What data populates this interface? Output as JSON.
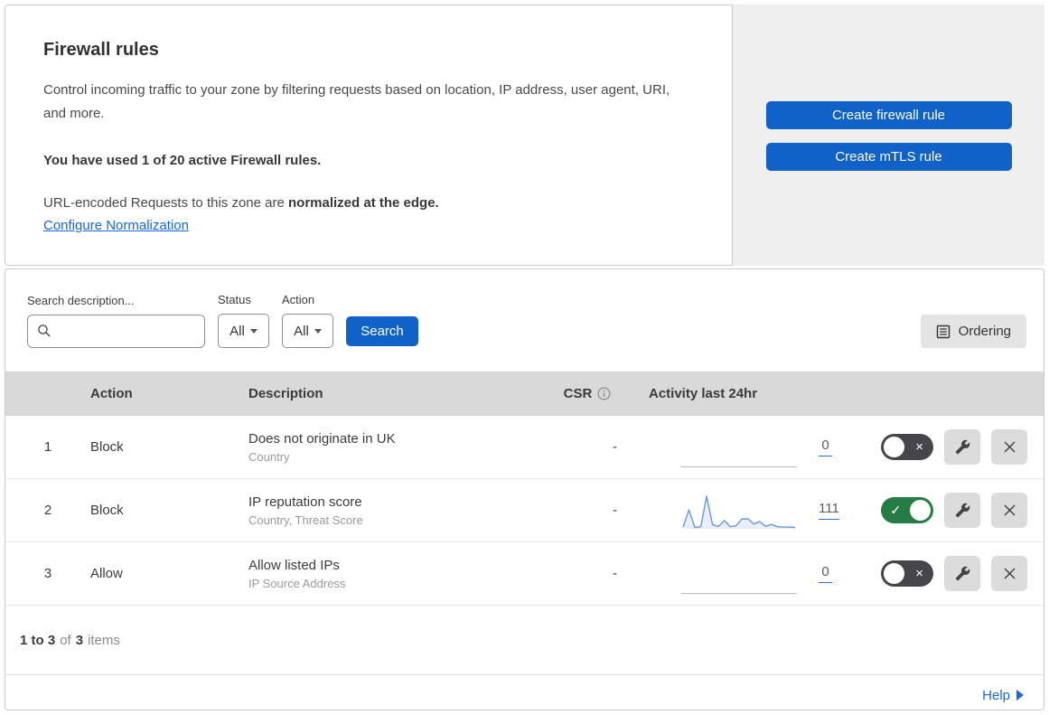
{
  "header": {
    "title": "Firewall rules",
    "description": "Control incoming traffic to your zone by filtering requests based on location, IP address, user agent, URI, and more.",
    "usage_note": "You have used 1 of 20 active Firewall rules.",
    "normalization_prefix": "URL-encoded Requests to this zone are ",
    "normalization_bold": "normalized at the edge.",
    "normalization_link": "Configure Normalization",
    "create_firewall_button": "Create firewall rule",
    "create_mtls_button": "Create mTLS rule"
  },
  "filters": {
    "search_label": "Search description...",
    "search_value": "",
    "status_label": "Status",
    "status_value": "All",
    "action_label": "Action",
    "action_value": "All",
    "search_button": "Search",
    "ordering_button": "Ordering"
  },
  "table": {
    "columns": {
      "action": "Action",
      "description": "Description",
      "csr": "CSR",
      "activity": "Activity last 24hr"
    },
    "rows": [
      {
        "num": "1",
        "action": "Block",
        "description": "Does not originate in UK",
        "fields": "Country",
        "csr": "-",
        "count": "0",
        "enabled": false,
        "sparkline": []
      },
      {
        "num": "2",
        "action": "Block",
        "description": "IP reputation score",
        "fields": "Country, Threat Score",
        "csr": "-",
        "count": "111",
        "enabled": true,
        "sparkline": [
          5,
          55,
          4,
          6,
          95,
          12,
          7,
          24,
          6,
          9,
          29,
          29,
          14,
          21,
          7,
          13,
          6,
          5,
          5,
          4
        ]
      },
      {
        "num": "3",
        "action": "Allow",
        "description": "Allow listed IPs",
        "fields": "IP Source Address",
        "csr": "-",
        "count": "0",
        "enabled": false,
        "sparkline": []
      }
    ]
  },
  "footer": {
    "range": "1 to 3",
    "of_label": "of",
    "total": "3",
    "items_label": "items",
    "help_label": "Help"
  },
  "colors": {
    "accent_blue": "#1162c8",
    "link_blue": "#1668dd",
    "toggle_on_green": "#267d43",
    "toggle_off_gray": "#46454b",
    "sparkline_blue": "#6b96dd",
    "table_header_gray": "#d9d9d9",
    "panel_gray": "#efefef"
  }
}
